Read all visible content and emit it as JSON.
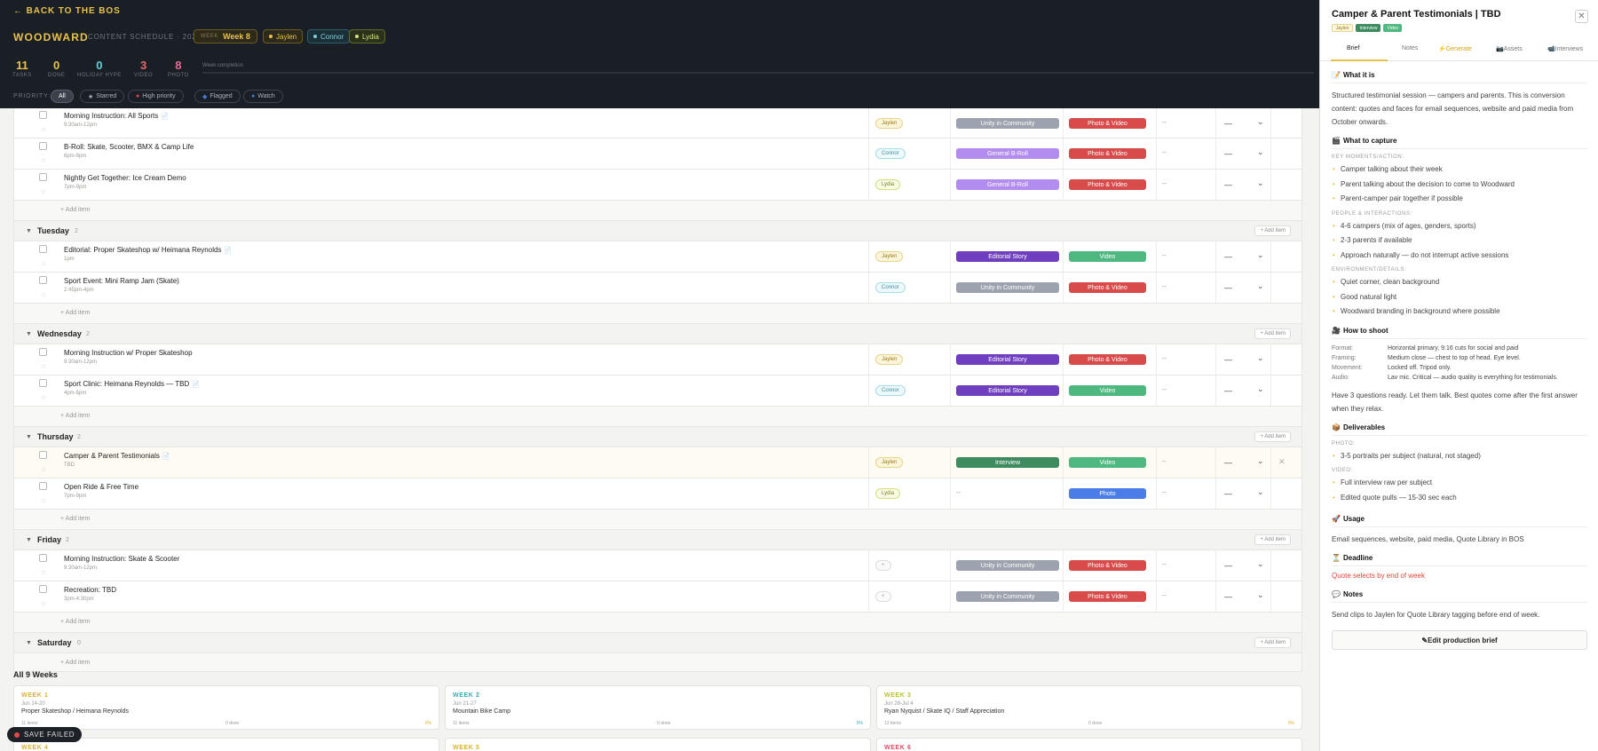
{
  "header": {
    "back": "← BACK TO THE BOS",
    "brand": "WOODWARD",
    "subtitle": "CONTENT SCHEDULE · 2026",
    "week_label": "WEEK",
    "week_value": "Week 8",
    "people": [
      "Jaylen",
      "Connor",
      "Lydia"
    ],
    "completion_label": "Week completion",
    "priority_label": "PRIORITY:",
    "chips": [
      "All",
      "Starred",
      "High priority",
      "Flagged",
      "Watch"
    ]
  },
  "stats": [
    {
      "n": "11",
      "l": "TASKS"
    },
    {
      "n": "0",
      "l": "DONE"
    },
    {
      "n": "0",
      "l": "HOLIDAY HYPE"
    },
    {
      "n": "3",
      "l": "VIDEO"
    },
    {
      "n": "8",
      "l": "PHOTO"
    }
  ],
  "ui": {
    "add_item": "+ Add item",
    "add_item_btn": "+ Add item",
    "save_status": "SAVE FAILED"
  },
  "days": [
    {
      "name": "Tuesday",
      "count": "2"
    },
    {
      "name": "Wednesday",
      "count": "2"
    },
    {
      "name": "Thursday",
      "count": "2"
    },
    {
      "name": "Friday",
      "count": "2"
    },
    {
      "name": "Saturday",
      "count": "0"
    }
  ],
  "rows": [
    {
      "title": "Morning Instruction: All Sports",
      "time": "9:30am-12pm",
      "who": "Jaylen",
      "cat": "Unity in Community",
      "fmt": "Photo & Video",
      "due": "--",
      "status": "—"
    },
    {
      "title": "B-Roll: Skate, Scooter, BMX & Camp Life",
      "time": "6pm-8pm",
      "who": "Connor",
      "cat": "General B-Roll",
      "fmt": "Photo & Video",
      "due": "--",
      "status": "—"
    },
    {
      "title": "Nightly Get Together: Ice Cream Demo",
      "time": "7pm-9pm",
      "who": "Lydia",
      "cat": "General B-Roll",
      "fmt": "Photo & Video",
      "due": "--",
      "status": "—"
    },
    {
      "title": "Editorial: Proper Skateshop w/ Heimana Reynolds",
      "time": "1pm",
      "who": "Jaylen",
      "cat": "Editorial Story",
      "fmt": "Video",
      "due": "--",
      "status": "—"
    },
    {
      "title": "Sport Event: Mini Ramp Jam (Skate)",
      "time": "2:45pm-4pm",
      "who": "Connor",
      "cat": "Unity in Community",
      "fmt": "Photo & Video",
      "due": "--",
      "status": "—"
    },
    {
      "title": "Morning Instruction w/ Proper Skateshop",
      "time": "9:30am-12pm",
      "who": "Jaylen",
      "cat": "Editorial Story",
      "fmt": "Photo & Video",
      "due": "--",
      "status": "—"
    },
    {
      "title": "Sport Clinic: Heimana Reynolds — TBD",
      "time": "4pm-5pm",
      "who": "Connor",
      "cat": "Editorial Story",
      "fmt": "Video",
      "due": "--",
      "status": "—"
    },
    {
      "title": "Camper & Parent Testimonials",
      "time": "TBD",
      "who": "Jaylen",
      "cat": "Interview",
      "fmt": "Video",
      "due": "--",
      "status": "—"
    },
    {
      "title": "Open Ride & Free Time",
      "time": "7pm-9pm",
      "who": "Lydia",
      "cat": "--",
      "fmt": "Photo",
      "due": "--",
      "status": "—"
    },
    {
      "title": "Morning Instruction: Skate & Scooter",
      "time": "9:30am-12pm",
      "who": "+",
      "cat": "Unity in Community",
      "fmt": "Photo & Video",
      "due": "--",
      "status": "—"
    },
    {
      "title": "Recreation: TBD",
      "time": "3pm-4:30pm",
      "who": "+",
      "cat": "Unity in Community",
      "fmt": "Photo & Video",
      "due": "--",
      "status": "—"
    }
  ],
  "all_weeks": {
    "title": "All 9 Weeks",
    "cards": [
      {
        "label": "WEEK 1",
        "dates": "Jun 14-20",
        "subtitle": "Proper Skateshop / Heimana Reynolds",
        "items": "11 items",
        "done": "0 done",
        "pct": "0%"
      },
      {
        "label": "WEEK 2",
        "dates": "Jun 21-27",
        "subtitle": "Mountain Bike Camp",
        "items": "11 items",
        "done": "0 done",
        "pct": "0%"
      },
      {
        "label": "WEEK 3",
        "dates": "Jun 28-Jul 4",
        "subtitle": "Ryan Nyquist / Skate IQ / Staff Appreciation",
        "items": "13 items",
        "done": "0 done",
        "pct": "0%"
      },
      {
        "label": "WEEK 4"
      },
      {
        "label": "WEEK 5"
      },
      {
        "label": "WEEK 6"
      }
    ]
  },
  "panel": {
    "title": "Camper & Parent Testimonials | TBD",
    "tags": [
      "Jaylen",
      "Interview",
      "Video"
    ],
    "tabs": [
      "Brief",
      "Notes",
      "Generate",
      "Assets",
      "Interviews"
    ],
    "what_it_is": {
      "heading": "What it is",
      "text": "Structured testimonial session — campers and parents. This is conversion content: quotes and faces for email sequences, website and paid media from October onwards."
    },
    "capture": {
      "heading": "What to capture",
      "groups": [
        {
          "label": "KEY MOMENTS/ACTION:",
          "items": [
            "Camper talking about their week",
            "Parent talking about the decision to come to Woodward",
            "Parent-camper pair together if possible"
          ]
        },
        {
          "label": "PEOPLE & INTERACTIONS:",
          "items": [
            "4-6 campers (mix of ages, genders, sports)",
            "2-3 parents if available",
            "Approach naturally — do not interrupt active sessions"
          ]
        },
        {
          "label": "ENVIRONMENT/DETAILS:",
          "items": [
            "Quiet corner, clean background",
            "Good natural light",
            "Woodward branding in background where possible"
          ]
        }
      ]
    },
    "shoot": {
      "heading": "How to shoot",
      "rows": [
        {
          "k": "Format:",
          "v": "Horizontal primary, 9:16 cuts for social and paid"
        },
        {
          "k": "Framing:",
          "v": "Medium close — chest to top of head. Eye level."
        },
        {
          "k": "Movement:",
          "v": "Locked off. Tripod only."
        },
        {
          "k": "Audio:",
          "v": "Lav mic. Critical — audio quality is everything for testimonials."
        }
      ],
      "note": "Have 3 questions ready. Let them talk. Best quotes come after the first answer when they relax."
    },
    "deliverables": {
      "heading": "Deliverables",
      "groups": [
        {
          "label": "PHOTO:",
          "items": [
            "3-5 portraits per subject (natural, not staged)"
          ]
        },
        {
          "label": "VIDEO:",
          "items": [
            "Full interview raw per subject",
            "Edited quote pulls — 15-30 sec each"
          ]
        }
      ]
    },
    "usage": {
      "heading": "Usage",
      "text": "Email sequences, website, paid media, Quote Library in BOS"
    },
    "deadline": {
      "heading": "Deadline",
      "text": "Quote selects by end of week"
    },
    "notes": {
      "heading": "Notes",
      "text": "Send clips to Jaylen for Quote Library tagging before end of week."
    },
    "edit_button": "Edit production brief"
  }
}
